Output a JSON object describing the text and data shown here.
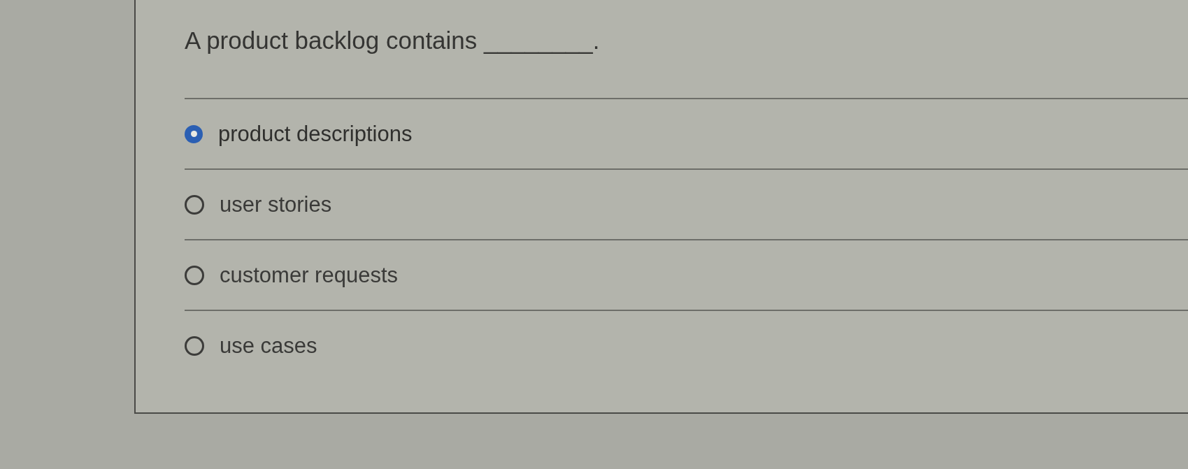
{
  "question": {
    "text": "A product backlog contains ________."
  },
  "answers": [
    {
      "label": "product descriptions",
      "selected": true
    },
    {
      "label": "user stories",
      "selected": false
    },
    {
      "label": "customer requests",
      "selected": false
    },
    {
      "label": "use cases",
      "selected": false
    }
  ]
}
